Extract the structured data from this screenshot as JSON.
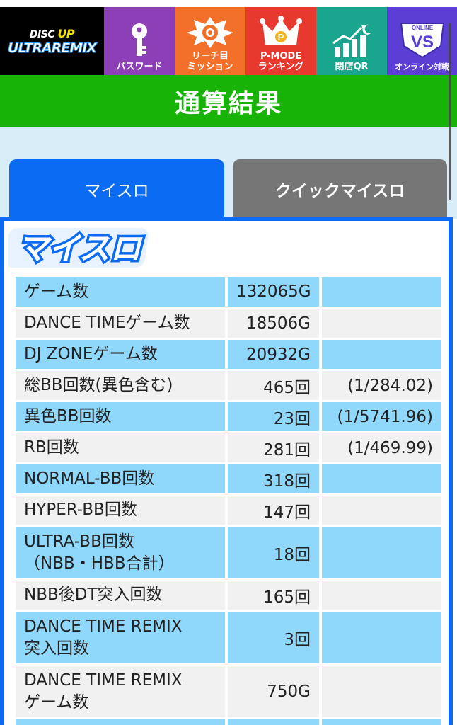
{
  "nav": {
    "logo_line1_a": "DISC ",
    "logo_line1_b": "UP",
    "logo_line2": "ULTRAREMIX",
    "items": [
      {
        "label": "パスワード",
        "icon": "key-icon"
      },
      {
        "label": "リーチ目\nミッション",
        "icon": "reach-emblem-icon"
      },
      {
        "label": "P-MODE\nランキング",
        "icon": "crown-icon"
      },
      {
        "label": "閉店QR",
        "icon": "chart-moon-icon"
      },
      {
        "label": "オンライン対戦",
        "icon": "vs-emblem-icon",
        "badge": "ONLINE",
        "emblem": "VS"
      }
    ]
  },
  "title": "通算結果",
  "tabs": {
    "my": "マイスロ",
    "quick": "クイックマイスロ"
  },
  "panel": {
    "logo_text": "マイスロ"
  },
  "stats": [
    {
      "label": "ゲーム数",
      "value": "132065G",
      "rate": ""
    },
    {
      "label": "DANCE TIMEゲーム数",
      "value": "18506G",
      "rate": ""
    },
    {
      "label": "DJ ZONEゲーム数",
      "value": "20932G",
      "rate": ""
    },
    {
      "label": "総BB回数(異色含む)",
      "value": "465回",
      "rate": "(1/284.02)"
    },
    {
      "label": "異色BB回数",
      "value": "23回",
      "rate": "(1/5741.96)"
    },
    {
      "label": "RB回数",
      "value": "281回",
      "rate": "(1/469.99)"
    },
    {
      "label": "NORMAL-BB回数",
      "value": "318回",
      "rate": ""
    },
    {
      "label": "HYPER-BB回数",
      "value": "147回",
      "rate": ""
    },
    {
      "label": "ULTRA-BB回数\n（NBB・HBB合計）",
      "value": "18回",
      "rate": ""
    },
    {
      "label": "NBB後DT突入回数",
      "value": "165回",
      "rate": ""
    },
    {
      "label": "DANCE TIME REMIX\n突入回数",
      "value": "3回",
      "rate": ""
    },
    {
      "label": "DANCE TIME REMIX\nゲーム数",
      "value": "750G",
      "rate": ""
    },
    {
      "label": "",
      "value": "",
      "rate": ""
    }
  ],
  "colors": {
    "row_blue": "#8fd7fb",
    "row_grey": "#f1f1f1",
    "tab_active": "#0b6cf3",
    "tab_inactive": "#767676",
    "title_green": "#17b306"
  }
}
